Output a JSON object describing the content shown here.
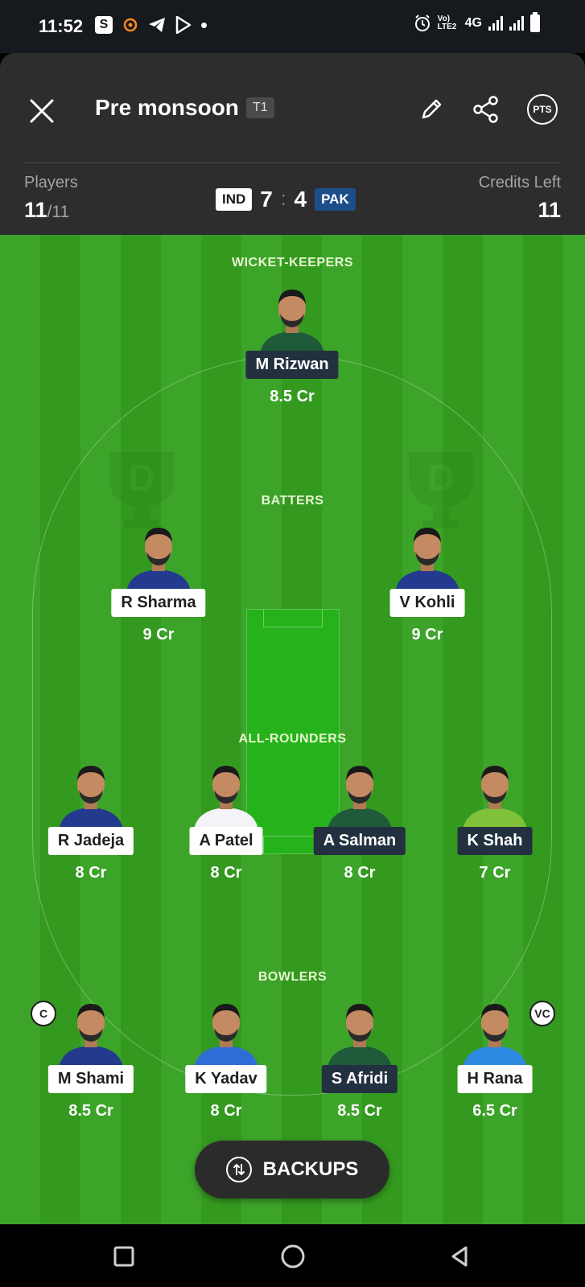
{
  "status_bar": {
    "time": "11:52",
    "network": "4G",
    "volte": "Vo) LTE2"
  },
  "header": {
    "team_name": "Pre monsoon",
    "team_tag": "T1",
    "players_label": "Players",
    "players_selected": "11",
    "players_max": "/11",
    "credits_label": "Credits Left",
    "credits_left": "11",
    "score": {
      "team1": "IND",
      "team1_count": "7",
      "separator": ":",
      "team2_count": "4",
      "team2": "PAK"
    },
    "pts_label": "PTS"
  },
  "field": {
    "sections": {
      "wicket_keepers": "WICKET-KEEPERS",
      "batters": "BATTERS",
      "all_rounders": "ALL-ROUNDERS",
      "bowlers": "BOWLERS"
    },
    "wicket_keepers": [
      {
        "name": "M Rizwan",
        "credits": "8.5 Cr",
        "team": "PAK",
        "jersey": "#1f5a3a"
      }
    ],
    "batters": [
      {
        "name": "R Sharma",
        "credits": "9 Cr",
        "team": "IND",
        "jersey": "#233a8f"
      },
      {
        "name": "V Kohli",
        "credits": "9 Cr",
        "team": "IND",
        "jersey": "#233a8f"
      }
    ],
    "all_rounders": [
      {
        "name": "R Jadeja",
        "credits": "8 Cr",
        "team": "IND",
        "jersey": "#233a8f"
      },
      {
        "name": "A Patel",
        "credits": "8 Cr",
        "team": "IND",
        "jersey": "#f2f4f8"
      },
      {
        "name": "A Salman",
        "credits": "8 Cr",
        "team": "PAK",
        "jersey": "#1f5a3a"
      },
      {
        "name": "K Shah",
        "credits": "7 Cr",
        "team": "PAK",
        "jersey": "#7fc23a"
      }
    ],
    "bowlers": [
      {
        "name": "M Shami",
        "credits": "8.5 Cr",
        "team": "IND",
        "jersey": "#233a8f",
        "badge": "C"
      },
      {
        "name": "K Yadav",
        "credits": "8 Cr",
        "team": "IND",
        "jersey": "#2d6ed6"
      },
      {
        "name": "S Afridi",
        "credits": "8.5 Cr",
        "team": "PAK",
        "jersey": "#1f5a3a"
      },
      {
        "name": "H Rana",
        "credits": "6.5 Cr",
        "team": "IND",
        "jersey": "#2e8ae0",
        "badge": "VC"
      }
    ]
  },
  "backups_label": "BACKUPS",
  "colors": {
    "header_bg": "#2d2d2d",
    "field_green": "#3da42a",
    "ind_pill": "#ffffff",
    "pak_pill": "#22303f"
  }
}
